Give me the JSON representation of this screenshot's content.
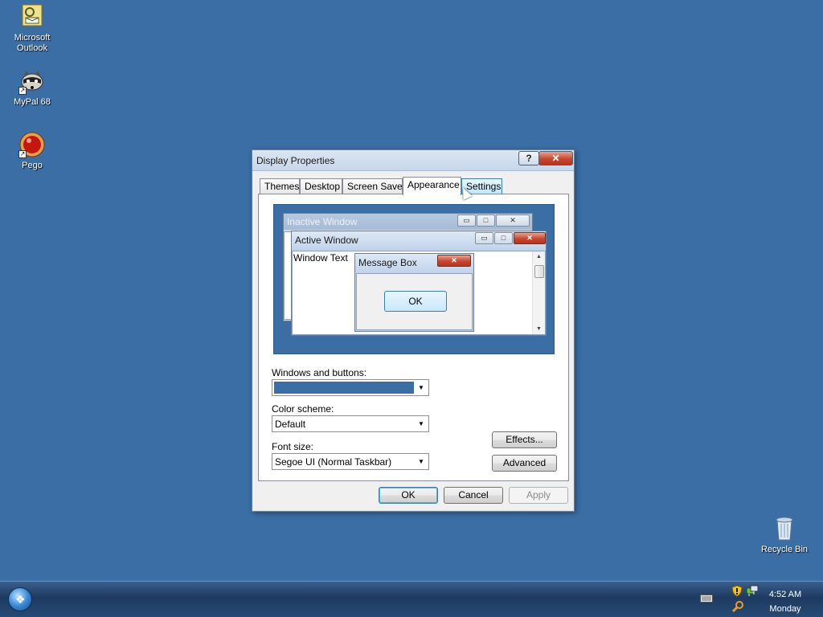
{
  "desktop": {
    "icons": [
      {
        "label_line1": "Microsoft",
        "label_line2": "Outlook",
        "icon": "outlook-icon"
      },
      {
        "label_line1": "MyPal 68",
        "label_line2": "",
        "icon": "mypal-raccoon-icon"
      },
      {
        "label_line1": "Pego",
        "label_line2": "",
        "icon": "pego-red-ball-icon"
      },
      {
        "label_line1": "Recycle Bin",
        "label_line2": "",
        "icon": "recycle-bin-icon"
      }
    ]
  },
  "dialog": {
    "title": "Display Properties",
    "help_glyph": "?",
    "close_glyph": "✕",
    "tabs": [
      "Themes",
      "Desktop",
      "Screen Saver",
      "Appearance",
      "Settings"
    ],
    "active_tab": "Appearance",
    "preview": {
      "inactive_title": "Inactive Window",
      "active_title": "Active Window",
      "window_text": "Window Text",
      "message_title": "Message Box",
      "message_ok": "OK",
      "min_glyph": "▭",
      "max_glyph": "□",
      "close_glyph": "✕",
      "scroll_up": "▲",
      "scroll_down": "▼"
    },
    "windows_buttons": {
      "label": "Windows and buttons:",
      "value": ""
    },
    "color_scheme": {
      "label": "Color scheme:",
      "value": "Default"
    },
    "font_size": {
      "label": "Font size:",
      "value": "Segoe UI (Normal Taskbar)"
    },
    "dropdown_glyph": "▼",
    "effects_label": "Effects...",
    "advanced_label": "Advanced",
    "ok_label": "OK",
    "cancel_label": "Cancel",
    "apply_label": "Apply"
  },
  "taskbar": {
    "start_glyph": "❖",
    "tray_icons": [
      "keyboard-icon",
      "security-shield-icon",
      "network-icon",
      "search-icon"
    ],
    "time": "4:52 AM",
    "day": "Monday"
  },
  "colors": {
    "desktop": "#3a6ea5",
    "selected_swatch": "#3a6ea5"
  }
}
